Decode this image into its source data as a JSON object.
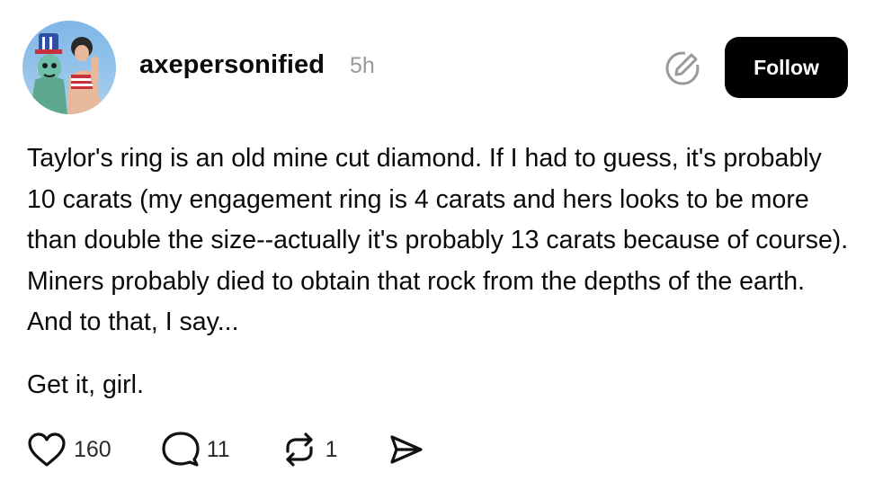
{
  "post": {
    "username": "axepersonified",
    "timestamp": "5h",
    "follow_label": "Follow",
    "paragraphs": [
      "Taylor's ring is an old mine cut diamond. If I had to guess, it's probably 10 carats (my engagement ring is 4 carats and hers looks to be more than double the size--actually it's probably 13 carats because of course). Miners probably died to obtain that rock from the depths of the earth. And to that, I say...",
      "Get it, girl."
    ]
  },
  "actions": {
    "likes": "160",
    "replies": "11",
    "reposts": "1"
  },
  "icons": {
    "avatar": "profile-avatar",
    "edit": "pencil-circle-icon",
    "like": "heart-icon",
    "reply": "speech-bubble-icon",
    "repost": "repost-arrows-icon",
    "share": "send-arrow-icon"
  },
  "colors": {
    "follow_bg": "#000000",
    "muted_text": "#9a9a9a",
    "body_text": "#0a0a0a"
  }
}
